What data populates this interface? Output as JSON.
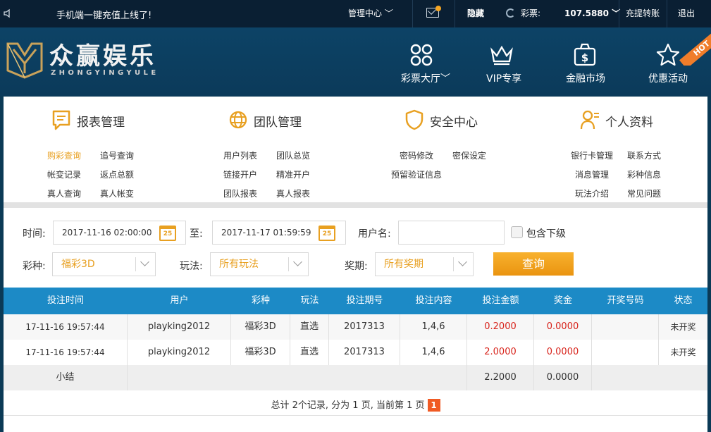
{
  "topbar": {
    "notice": "手机端一键充值上线了!",
    "manage_center": "管理中心",
    "hide": "隐藏",
    "balance_label": "彩票:",
    "balance_value": "107.5880",
    "transfer": "充提转账",
    "logout": "退出"
  },
  "header": {
    "logo_text": "众赢娱乐",
    "logo_sub": "ZHONGYINGYULE",
    "nav": [
      {
        "label": "彩票大厅",
        "icon": "grid-icon"
      },
      {
        "label": "VIP专享",
        "icon": "crown-icon"
      },
      {
        "label": "金融市场",
        "icon": "money-bag-icon"
      },
      {
        "label": "优惠活动",
        "icon": "star-icon"
      }
    ],
    "hot_badge": "HOT"
  },
  "sections": [
    {
      "title": "报表管理",
      "links": [
        "购彩查询",
        "追号查询",
        "帐变记录",
        "返点总额",
        "真人查询",
        "真人帐变"
      ]
    },
    {
      "title": "团队管理",
      "links": [
        "用户列表",
        "团队总览",
        "链接开户",
        "精准开户",
        "团队报表",
        "真人报表"
      ]
    },
    {
      "title": "安全中心",
      "links": [
        "密码修改",
        "密保设定",
        "预留验证信息"
      ]
    },
    {
      "title": "个人资料",
      "links": [
        "银行卡管理",
        "联系方式",
        "消息管理",
        "彩种信息",
        "玩法介绍",
        "常见问题"
      ]
    }
  ],
  "filter": {
    "time_label": "时间:",
    "start_time": "2017-11-16 02:00:00",
    "to_label": "至:",
    "end_time": "2017-11-17 01:59:59",
    "calendar_day": "25",
    "username_label": "用户名:",
    "username_value": "",
    "include_sub_label": "包含下级",
    "lottery_label": "彩种:",
    "lottery_value": "福彩3D",
    "play_label": "玩法:",
    "play_value": "所有玩法",
    "issue_label": "奖期:",
    "issue_value": "所有奖期",
    "query_button": "查询"
  },
  "table": {
    "headers": [
      "投注时间",
      "用户",
      "彩种",
      "玩法",
      "投注期号",
      "投注内容",
      "投注金额",
      "奖金",
      "开奖号码",
      "状态"
    ],
    "rows": [
      [
        "17-11-16 19:57:44",
        "playking2012",
        "福彩3D",
        "直选",
        "2017313",
        "1,4,6",
        "0.2000",
        "0.0000",
        "",
        "未开奖"
      ],
      [
        "17-11-16 19:57:44",
        "playking2012",
        "福彩3D",
        "直选",
        "2017313",
        "1,4,6",
        "2.0000",
        "0.0000",
        "",
        "未开奖"
      ]
    ],
    "subtotal_label": "小结",
    "subtotal_amount": "2.2000",
    "subtotal_bonus": "0.0000"
  },
  "pager": {
    "text": "总计 2个记录, 分为 1 页, 当前第 1 页",
    "current": "1"
  },
  "colors": {
    "accent": "#e8a021",
    "table_header": "#1c8ac6",
    "red": "#d8241c",
    "topbar": "#0a1f33",
    "header": "#0d4366"
  }
}
